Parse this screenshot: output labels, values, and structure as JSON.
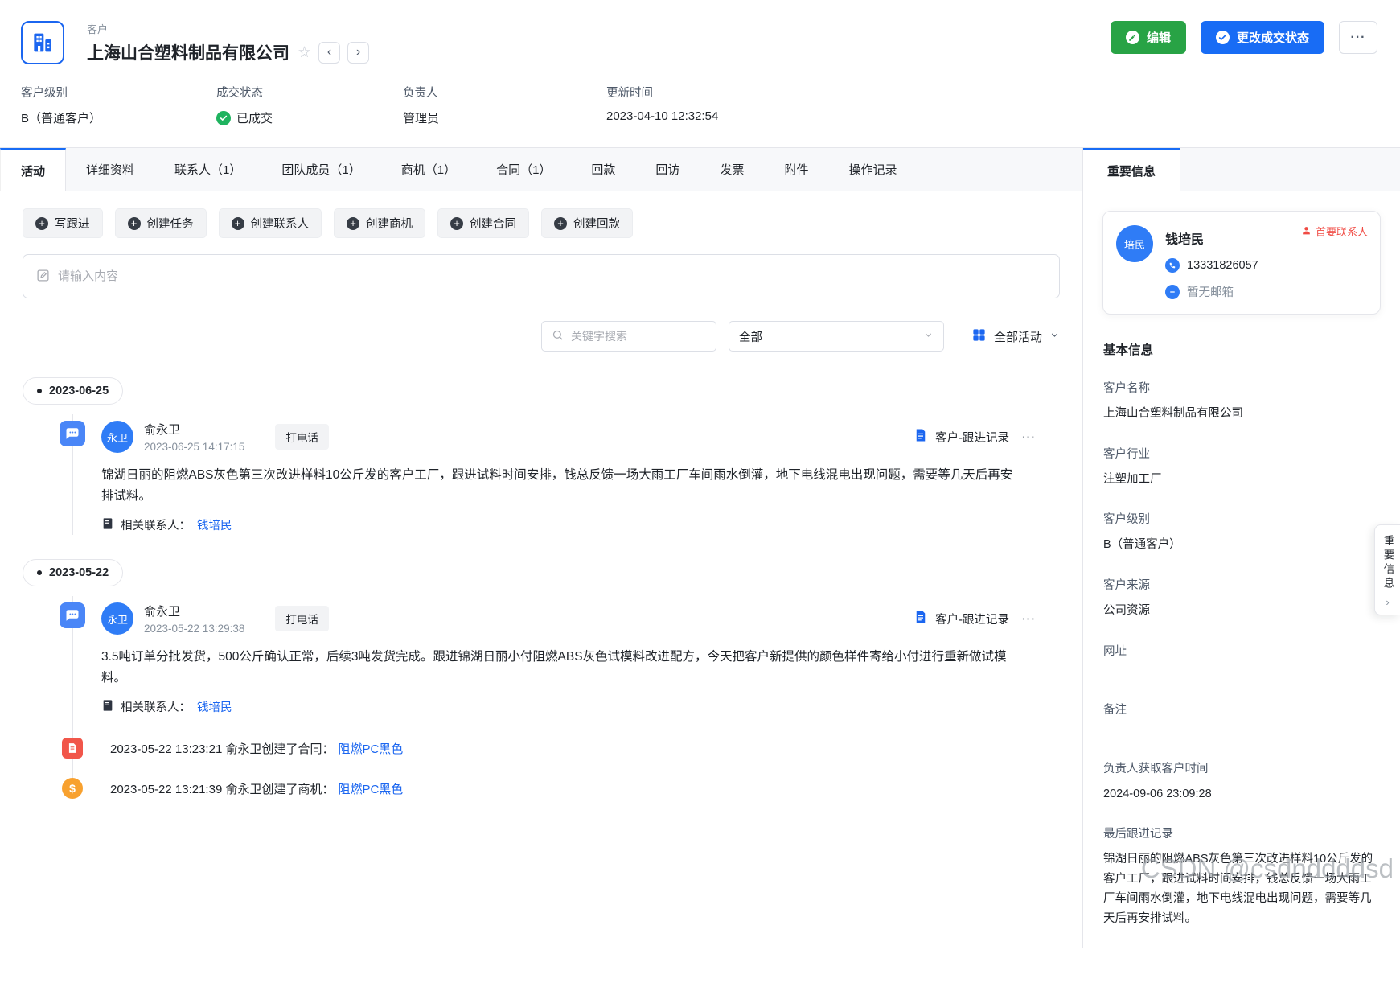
{
  "icons": {
    "more": "···",
    "star": "☆",
    "prev": "‹",
    "next": "›",
    "plus": "+",
    "dollar": "$"
  },
  "header": {
    "entity_label": "客户",
    "title": "上海山合塑料制品有限公司",
    "edit_button": "编辑",
    "change_status_button": "更改成交状态",
    "fields": [
      {
        "label": "客户级别",
        "value": "B（普通客户）"
      },
      {
        "label": "成交状态",
        "value": "已成交"
      },
      {
        "label": "负责人",
        "value": "管理员"
      },
      {
        "label": "更新时间",
        "value": "2023-04-10 12:32:54"
      }
    ]
  },
  "tabs": [
    {
      "label": "活动"
    },
    {
      "label": "详细资料"
    },
    {
      "label": "联系人（1）"
    },
    {
      "label": "团队成员（1）"
    },
    {
      "label": "商机（1）"
    },
    {
      "label": "合同（1）"
    },
    {
      "label": "回款"
    },
    {
      "label": "回访"
    },
    {
      "label": "发票"
    },
    {
      "label": "附件"
    },
    {
      "label": "操作记录"
    }
  ],
  "quick_actions": [
    {
      "label": "写跟进"
    },
    {
      "label": "创建任务"
    },
    {
      "label": "创建联系人"
    },
    {
      "label": "创建商机"
    },
    {
      "label": "创建合同"
    },
    {
      "label": "创建回款"
    }
  ],
  "composer": {
    "placeholder": "请输入内容"
  },
  "filters": {
    "keyword_placeholder": "关键字搜索",
    "type_value": "全部",
    "activity_value": "全部活动"
  },
  "timeline": {
    "groups": [
      {
        "date": "2023-06-25",
        "record": {
          "avatar": "永卫",
          "user": "俞永卫",
          "time": "2023-06-25 14:17:15",
          "tag": "打电话",
          "source": "客户-跟进记录",
          "content": "锦湖日丽的阻燃ABS灰色第三次改进样料10公斤发的客户工厂，跟进试料时间安排，钱总反馈一场大雨工厂车间雨水倒灌，地下电线混电出现问题，需要等几天后再安排试料。",
          "related_label": "相关联系人：",
          "related_contact": "钱培民"
        }
      },
      {
        "date": "2023-05-22",
        "record": {
          "avatar": "永卫",
          "user": "俞永卫",
          "time": "2023-05-22 13:29:38",
          "tag": "打电话",
          "source": "客户-跟进记录",
          "content": "3.5吨订单分批发货，500公斤确认正常，后续3吨发货完成。跟进锦湖日丽小付阻燃ABS灰色试模料改进配方，今天把客户新提供的颜色样件寄给小付进行重新做试模料。",
          "related_label": "相关联系人：",
          "related_contact": "钱培民"
        },
        "events": [
          {
            "text": "2023-05-22 13:23:21 俞永卫创建了合同：",
            "link": "阻燃PC黑色"
          },
          {
            "text": "2023-05-22 13:21:39 俞永卫创建了商机：",
            "link": "阻燃PC黑色"
          }
        ]
      }
    ]
  },
  "sidebar": {
    "tab": "重要信息",
    "contact_card": {
      "avatar": "培民",
      "name": "钱培民",
      "primary_badge": "首要联系人",
      "phone": "13331826057",
      "email": "暂无邮箱"
    },
    "basic_info_title": "基本信息",
    "fields": [
      {
        "label": "客户名称",
        "value": "上海山合塑料制品有限公司"
      },
      {
        "label": "客户行业",
        "value": "注塑加工厂"
      },
      {
        "label": "客户级别",
        "value": "B（普通客户）"
      },
      {
        "label": "客户来源",
        "value": "公司资源"
      },
      {
        "label": "网址",
        "value": ""
      },
      {
        "label": "备注",
        "value": ""
      },
      {
        "label": "负责人获取客户时间",
        "value": "2024-09-06 23:09:28"
      },
      {
        "label": "最后跟进记录",
        "value": "锦湖日丽的阻燃ABS灰色第三次改进样料10公斤发的客户工厂，跟进试料时间安排，钱总反馈一场大雨工厂车间雨水倒灌，地下电线混电出现问题，需要等几天后再安排试料。"
      }
    ],
    "collapse_tab": "重要信息"
  },
  "watermark": "CSDN @csdnddddsd"
}
